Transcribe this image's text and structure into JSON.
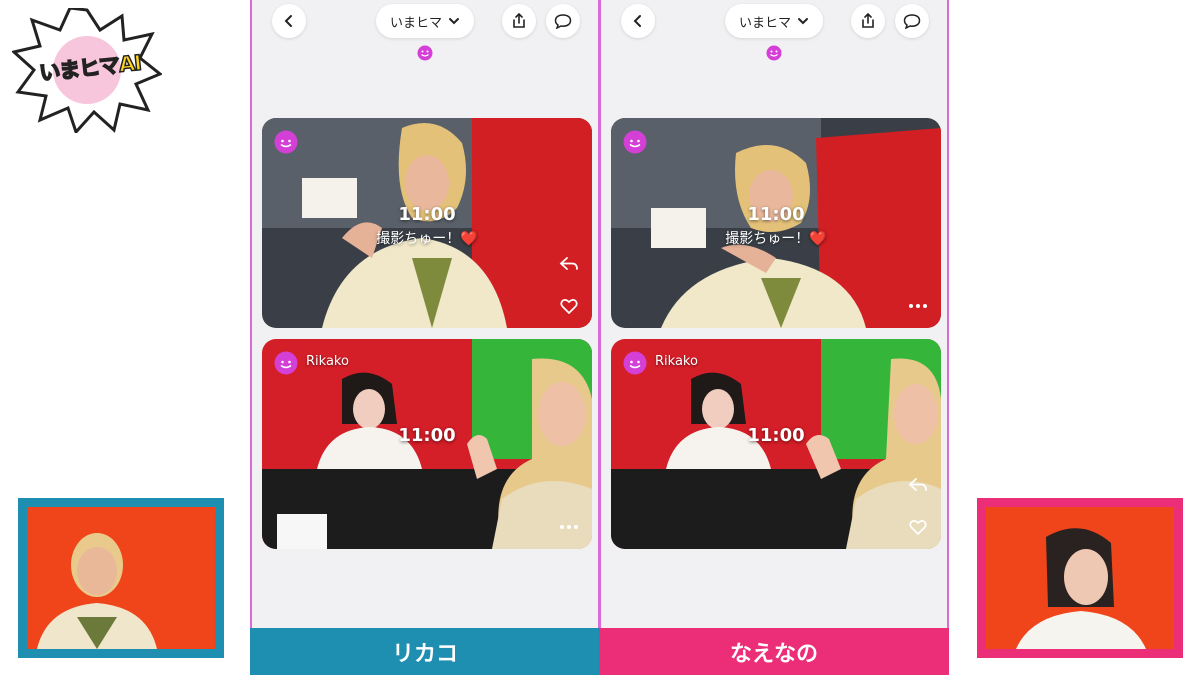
{
  "logo": {
    "text": "いまヒマAI"
  },
  "app": {
    "dropdown_label": "いまヒマ",
    "icons": [
      "back-chevron-icon",
      "share-icon",
      "chat-bubble-icon",
      "smiley-icon"
    ]
  },
  "panels": [
    {
      "contestant": "リカコ",
      "cards": [
        {
          "author": "",
          "time": "11:00",
          "caption": "撮影ちゅー！❤️",
          "actions": [
            "reply-icon",
            "heart-icon"
          ]
        },
        {
          "author": "Rikako",
          "time": "11:00",
          "caption": "",
          "actions": [
            "more-icon"
          ]
        }
      ]
    },
    {
      "contestant": "なえなの",
      "cards": [
        {
          "author": "",
          "time": "11:00",
          "caption": "撮影ちゅー！❤️",
          "actions": [
            "more-icon"
          ]
        },
        {
          "author": "Rikako",
          "time": "11:00",
          "caption": "",
          "actions": [
            "reply-icon",
            "heart-icon"
          ]
        }
      ]
    }
  ],
  "colors": {
    "left_accent": "#1e8fb1",
    "right_accent": "#ec2e78",
    "smiley": "#d43fd6",
    "webcam_bg": "#f0451b"
  }
}
